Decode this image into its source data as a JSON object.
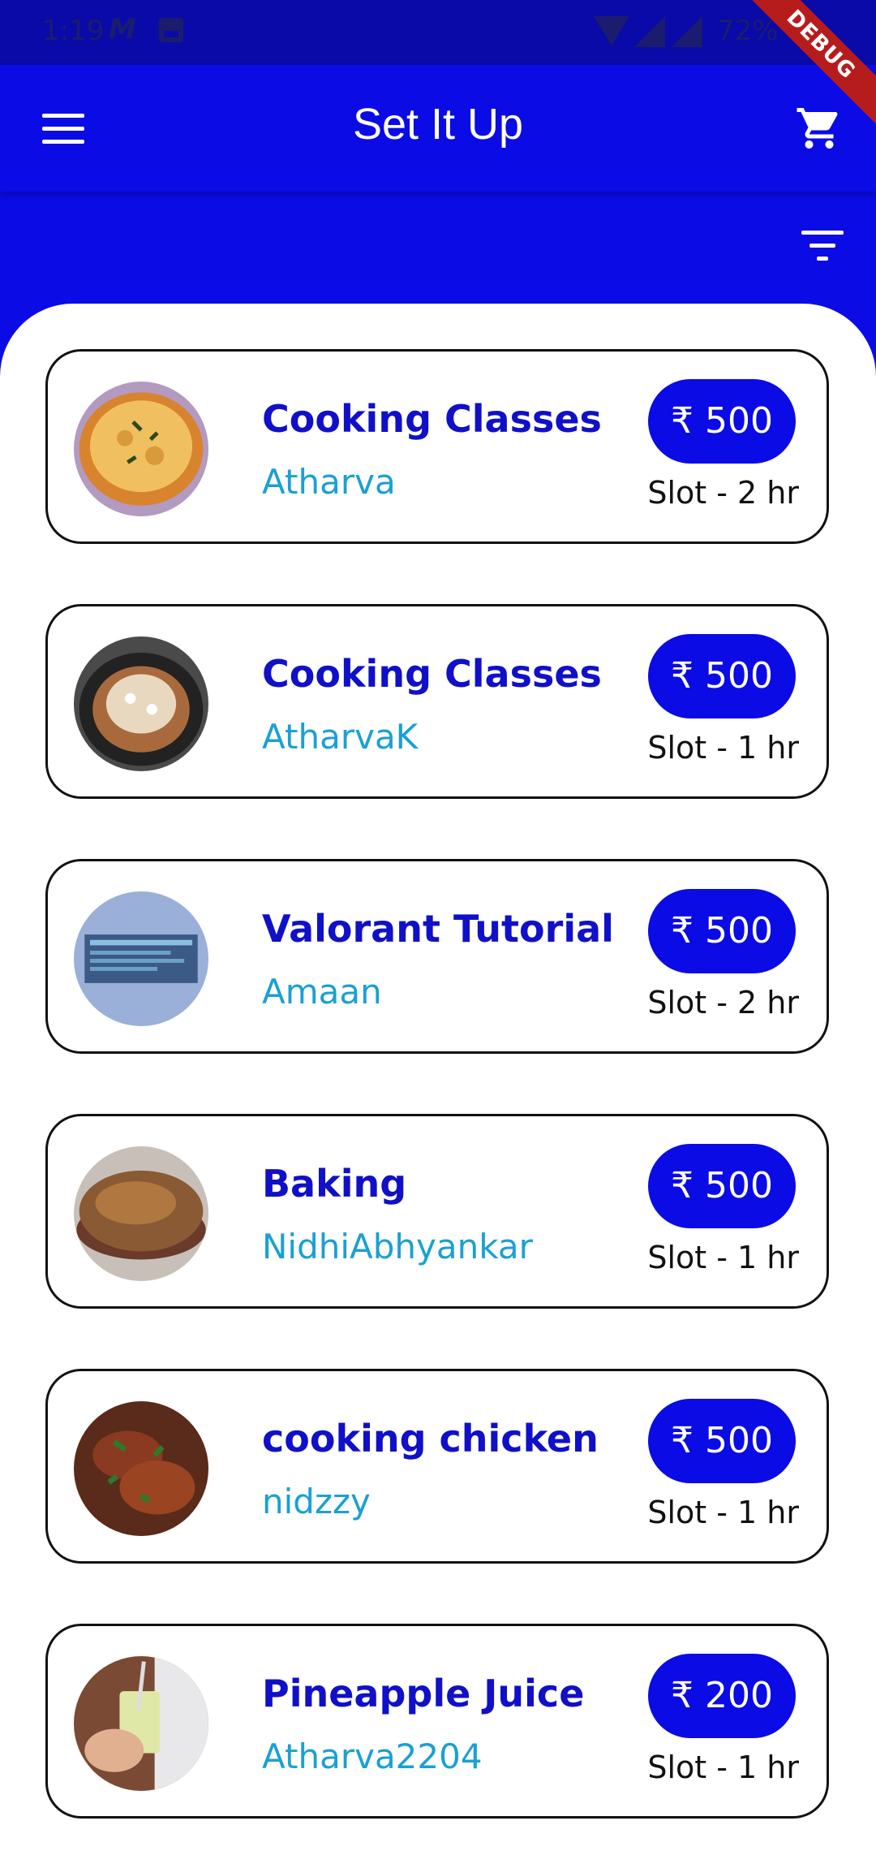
{
  "status_bar": {
    "time": "1:19",
    "battery": "72%"
  },
  "debug_banner": "DEBUG",
  "app_bar": {
    "title": "Set It Up"
  },
  "listings": [
    {
      "title": "Cooking Classes",
      "owner": "Atharva",
      "price": "₹ 500",
      "slot": "Slot - 2 hr",
      "image": "pizza"
    },
    {
      "title": "Cooking Classes",
      "owner": "AtharvaK",
      "price": "₹ 500",
      "slot": "Slot - 1 hr",
      "image": "pasta-pan"
    },
    {
      "title": "Valorant Tutorial",
      "owner": "Amaan",
      "price": "₹ 500",
      "slot": "Slot - 2 hr",
      "image": "game-screen"
    },
    {
      "title": "Baking",
      "owner": "NidhiAbhyankar",
      "price": "₹ 500",
      "slot": "Slot - 1 hr",
      "image": "bread"
    },
    {
      "title": "cooking chicken",
      "owner": "nidzzy",
      "price": "₹ 500",
      "slot": "Slot - 1 hr",
      "image": "chicken"
    },
    {
      "title": "Pineapple Juice",
      "owner": "Atharva2204",
      "price": "₹ 200",
      "slot": "Slot - 1 hr",
      "image": "juice-glass"
    }
  ],
  "colors": {
    "primary": "#0b0be6",
    "title_text": "#1010c8",
    "owner_text": "#1aa0d4",
    "debug": "#b71c1c"
  }
}
